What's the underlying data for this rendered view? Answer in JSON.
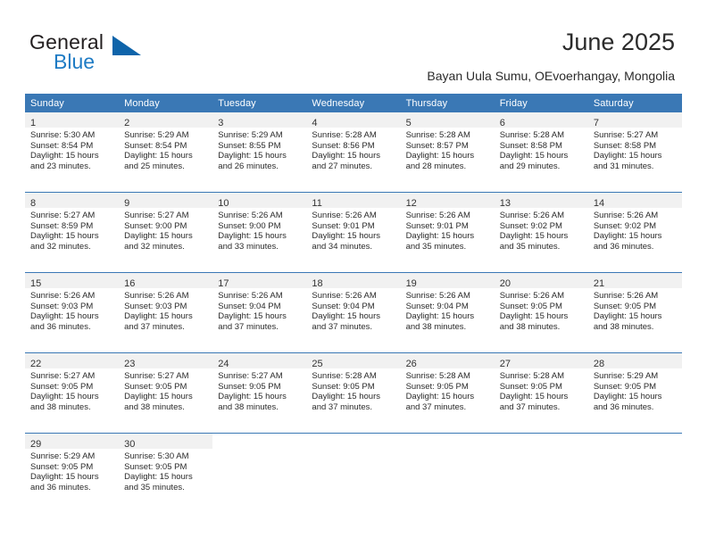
{
  "brand": {
    "name_part1": "General",
    "name_part2": "Blue",
    "triangle_icon": "blue-triangle-icon",
    "accent_color": "#0e64aa",
    "text_color": "#231f20"
  },
  "header": {
    "title": "June 2025",
    "subtitle": "Bayan Uula Sumu, OEvoerhangay, Mongolia"
  },
  "calendar": {
    "header_bg": "#3a78b5",
    "daynum_bg": "#f1f1f1",
    "weekday_headers": [
      "Sunday",
      "Monday",
      "Tuesday",
      "Wednesday",
      "Thursday",
      "Friday",
      "Saturday"
    ],
    "weeks": [
      [
        {
          "day": "1",
          "sunrise": "Sunrise: 5:30 AM",
          "sunset": "Sunset: 8:54 PM",
          "daylight_line1": "Daylight: 15 hours",
          "daylight_line2": "and 23 minutes."
        },
        {
          "day": "2",
          "sunrise": "Sunrise: 5:29 AM",
          "sunset": "Sunset: 8:54 PM",
          "daylight_line1": "Daylight: 15 hours",
          "daylight_line2": "and 25 minutes."
        },
        {
          "day": "3",
          "sunrise": "Sunrise: 5:29 AM",
          "sunset": "Sunset: 8:55 PM",
          "daylight_line1": "Daylight: 15 hours",
          "daylight_line2": "and 26 minutes."
        },
        {
          "day": "4",
          "sunrise": "Sunrise: 5:28 AM",
          "sunset": "Sunset: 8:56 PM",
          "daylight_line1": "Daylight: 15 hours",
          "daylight_line2": "and 27 minutes."
        },
        {
          "day": "5",
          "sunrise": "Sunrise: 5:28 AM",
          "sunset": "Sunset: 8:57 PM",
          "daylight_line1": "Daylight: 15 hours",
          "daylight_line2": "and 28 minutes."
        },
        {
          "day": "6",
          "sunrise": "Sunrise: 5:28 AM",
          "sunset": "Sunset: 8:58 PM",
          "daylight_line1": "Daylight: 15 hours",
          "daylight_line2": "and 29 minutes."
        },
        {
          "day": "7",
          "sunrise": "Sunrise: 5:27 AM",
          "sunset": "Sunset: 8:58 PM",
          "daylight_line1": "Daylight: 15 hours",
          "daylight_line2": "and 31 minutes."
        }
      ],
      [
        {
          "day": "8",
          "sunrise": "Sunrise: 5:27 AM",
          "sunset": "Sunset: 8:59 PM",
          "daylight_line1": "Daylight: 15 hours",
          "daylight_line2": "and 32 minutes."
        },
        {
          "day": "9",
          "sunrise": "Sunrise: 5:27 AM",
          "sunset": "Sunset: 9:00 PM",
          "daylight_line1": "Daylight: 15 hours",
          "daylight_line2": "and 32 minutes."
        },
        {
          "day": "10",
          "sunrise": "Sunrise: 5:26 AM",
          "sunset": "Sunset: 9:00 PM",
          "daylight_line1": "Daylight: 15 hours",
          "daylight_line2": "and 33 minutes."
        },
        {
          "day": "11",
          "sunrise": "Sunrise: 5:26 AM",
          "sunset": "Sunset: 9:01 PM",
          "daylight_line1": "Daylight: 15 hours",
          "daylight_line2": "and 34 minutes."
        },
        {
          "day": "12",
          "sunrise": "Sunrise: 5:26 AM",
          "sunset": "Sunset: 9:01 PM",
          "daylight_line1": "Daylight: 15 hours",
          "daylight_line2": "and 35 minutes."
        },
        {
          "day": "13",
          "sunrise": "Sunrise: 5:26 AM",
          "sunset": "Sunset: 9:02 PM",
          "daylight_line1": "Daylight: 15 hours",
          "daylight_line2": "and 35 minutes."
        },
        {
          "day": "14",
          "sunrise": "Sunrise: 5:26 AM",
          "sunset": "Sunset: 9:02 PM",
          "daylight_line1": "Daylight: 15 hours",
          "daylight_line2": "and 36 minutes."
        }
      ],
      [
        {
          "day": "15",
          "sunrise": "Sunrise: 5:26 AM",
          "sunset": "Sunset: 9:03 PM",
          "daylight_line1": "Daylight: 15 hours",
          "daylight_line2": "and 36 minutes."
        },
        {
          "day": "16",
          "sunrise": "Sunrise: 5:26 AM",
          "sunset": "Sunset: 9:03 PM",
          "daylight_line1": "Daylight: 15 hours",
          "daylight_line2": "and 37 minutes."
        },
        {
          "day": "17",
          "sunrise": "Sunrise: 5:26 AM",
          "sunset": "Sunset: 9:04 PM",
          "daylight_line1": "Daylight: 15 hours",
          "daylight_line2": "and 37 minutes."
        },
        {
          "day": "18",
          "sunrise": "Sunrise: 5:26 AM",
          "sunset": "Sunset: 9:04 PM",
          "daylight_line1": "Daylight: 15 hours",
          "daylight_line2": "and 37 minutes."
        },
        {
          "day": "19",
          "sunrise": "Sunrise: 5:26 AM",
          "sunset": "Sunset: 9:04 PM",
          "daylight_line1": "Daylight: 15 hours",
          "daylight_line2": "and 38 minutes."
        },
        {
          "day": "20",
          "sunrise": "Sunrise: 5:26 AM",
          "sunset": "Sunset: 9:05 PM",
          "daylight_line1": "Daylight: 15 hours",
          "daylight_line2": "and 38 minutes."
        },
        {
          "day": "21",
          "sunrise": "Sunrise: 5:26 AM",
          "sunset": "Sunset: 9:05 PM",
          "daylight_line1": "Daylight: 15 hours",
          "daylight_line2": "and 38 minutes."
        }
      ],
      [
        {
          "day": "22",
          "sunrise": "Sunrise: 5:27 AM",
          "sunset": "Sunset: 9:05 PM",
          "daylight_line1": "Daylight: 15 hours",
          "daylight_line2": "and 38 minutes."
        },
        {
          "day": "23",
          "sunrise": "Sunrise: 5:27 AM",
          "sunset": "Sunset: 9:05 PM",
          "daylight_line1": "Daylight: 15 hours",
          "daylight_line2": "and 38 minutes."
        },
        {
          "day": "24",
          "sunrise": "Sunrise: 5:27 AM",
          "sunset": "Sunset: 9:05 PM",
          "daylight_line1": "Daylight: 15 hours",
          "daylight_line2": "and 38 minutes."
        },
        {
          "day": "25",
          "sunrise": "Sunrise: 5:28 AM",
          "sunset": "Sunset: 9:05 PM",
          "daylight_line1": "Daylight: 15 hours",
          "daylight_line2": "and 37 minutes."
        },
        {
          "day": "26",
          "sunrise": "Sunrise: 5:28 AM",
          "sunset": "Sunset: 9:05 PM",
          "daylight_line1": "Daylight: 15 hours",
          "daylight_line2": "and 37 minutes."
        },
        {
          "day": "27",
          "sunrise": "Sunrise: 5:28 AM",
          "sunset": "Sunset: 9:05 PM",
          "daylight_line1": "Daylight: 15 hours",
          "daylight_line2": "and 37 minutes."
        },
        {
          "day": "28",
          "sunrise": "Sunrise: 5:29 AM",
          "sunset": "Sunset: 9:05 PM",
          "daylight_line1": "Daylight: 15 hours",
          "daylight_line2": "and 36 minutes."
        }
      ],
      [
        {
          "day": "29",
          "sunrise": "Sunrise: 5:29 AM",
          "sunset": "Sunset: 9:05 PM",
          "daylight_line1": "Daylight: 15 hours",
          "daylight_line2": "and 36 minutes."
        },
        {
          "day": "30",
          "sunrise": "Sunrise: 5:30 AM",
          "sunset": "Sunset: 9:05 PM",
          "daylight_line1": "Daylight: 15 hours",
          "daylight_line2": "and 35 minutes."
        },
        null,
        null,
        null,
        null,
        null
      ]
    ]
  }
}
